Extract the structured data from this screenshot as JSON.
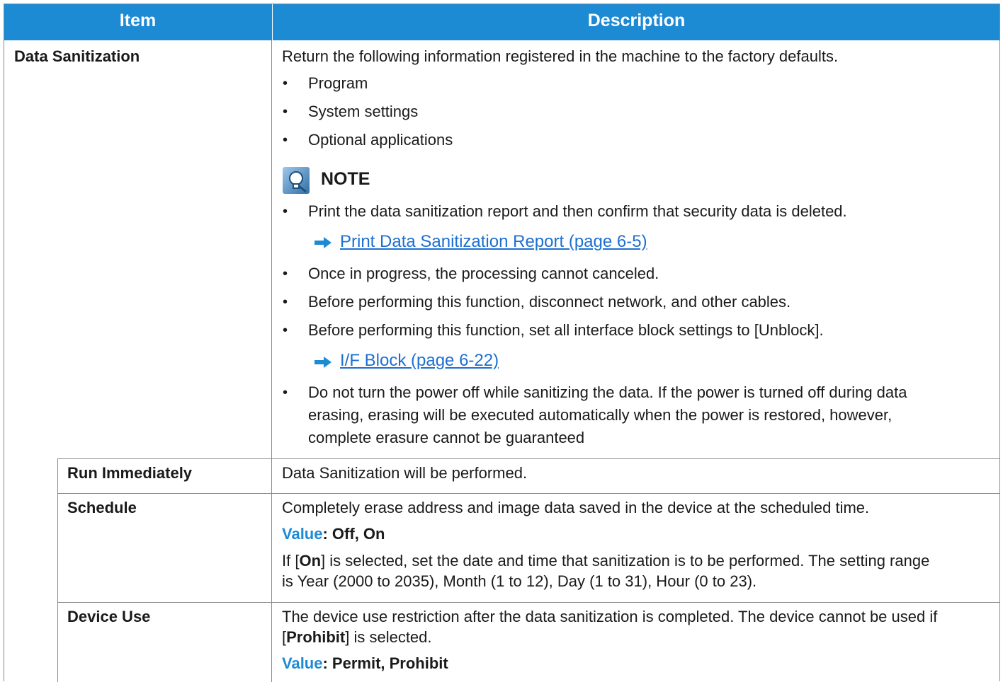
{
  "header": {
    "item": "Item",
    "description": "Description"
  },
  "data_sanitization": {
    "name": "Data Sanitization",
    "intro": "Return the following information registered in the machine to the factory defaults.",
    "items": [
      "Program",
      "System settings",
      "Optional applications"
    ],
    "note_title": "NOTE",
    "note_bullet_1": "Print the data sanitization report and then confirm that security data is deleted.",
    "link_1": "Print Data Sanitization Report (page 6-5)",
    "note_bullet_2": "Once in progress, the processing cannot canceled.",
    "note_bullet_3": "Before performing this function, disconnect network, and other cables.",
    "note_bullet_4": "Before performing this function, set all interface block settings to [Unblock].",
    "link_2": "I/F Block (page 6-22)",
    "note_bullet_5_lines": [
      "Do not turn the power off while sanitizing the data. If the power is turned off during data",
      "erasing, erasing will be executed automatically when the power is restored, however,",
      "complete erasure cannot be guaranteed"
    ]
  },
  "run_immediately": {
    "name": "Run Immediately",
    "description": "Data Sanitization will be performed."
  },
  "schedule": {
    "name": "Schedule",
    "description": "Completely erase address and image data saved in the device at the scheduled time.",
    "value_label": "Value",
    "value": ": Off, On",
    "detail_prefix": "If [",
    "detail_bold": "On",
    "detail_rest": "] is selected, set the date and time that sanitization is to be performed. The setting range",
    "detail_line2": "is Year (2000 to 2035), Month (1 to 12), Day (1 to 31), Hour (0 to 23)."
  },
  "device_use": {
    "name": "Device Use",
    "description_line1": "The device use restriction after the data sanitization is completed. The device cannot be used if",
    "description_bracket_open": "[",
    "description_bold": "Prohibit",
    "description_rest": "] is selected.",
    "value_label": "Value",
    "value": ": Permit, Prohibit"
  },
  "colors": {
    "header_bg": "#1d8ad4",
    "link": "#1d6fd0",
    "value_label": "#1d8ad4"
  },
  "icons": {
    "note": "note-lightbulb-icon",
    "arrow": "arrow-right-icon"
  }
}
